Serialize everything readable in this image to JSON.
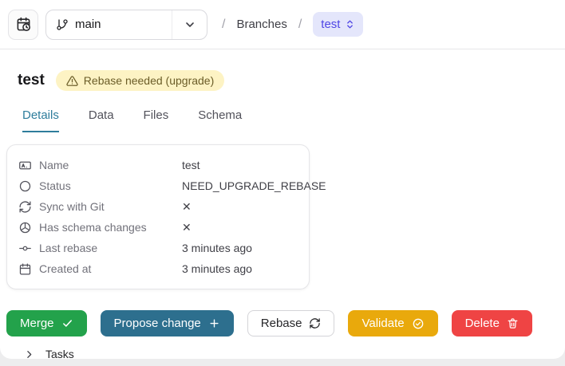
{
  "topbar": {
    "history_button": {
      "icon": "calendar-clock"
    },
    "branch_select": {
      "value": "main",
      "icon": "git-branch"
    },
    "breadcrumb": {
      "sep": "/",
      "section": "Branches",
      "current": "test"
    }
  },
  "header": {
    "title": "test",
    "badge": "Rebase needed (upgrade)"
  },
  "tabs": [
    {
      "label": "Details",
      "active": true
    },
    {
      "label": "Data",
      "active": false
    },
    {
      "label": "Files",
      "active": false
    },
    {
      "label": "Schema",
      "active": false
    }
  ],
  "details": {
    "rows": [
      {
        "icon": "name-field-icon",
        "label": "Name",
        "value": "test"
      },
      {
        "icon": "status-circle-icon",
        "label": "Status",
        "value": "NEED_UPGRADE_REBASE"
      },
      {
        "icon": "sync-icon",
        "label": "Sync with Git",
        "value": "✕"
      },
      {
        "icon": "schema-icon",
        "label": "Has schema changes",
        "value": "✕"
      },
      {
        "icon": "commit-icon",
        "label": "Last rebase",
        "value": "3 minutes ago"
      },
      {
        "icon": "calendar-icon",
        "label": "Created at",
        "value": "3 minutes ago"
      }
    ]
  },
  "actions": {
    "merge": "Merge",
    "propose": "Propose change",
    "rebase": "Rebase",
    "validate": "Validate",
    "delete": "Delete"
  },
  "tasks": {
    "label": "Tasks"
  },
  "colors": {
    "accent_teal": "#2d6f8e",
    "tab_active": "#2e7d9c",
    "merge_green": "#23a24b",
    "validate_amber": "#e9a90c",
    "delete_red": "#ef4444",
    "badge_bg": "#fdf3c4",
    "badge_text": "#6b5d28",
    "pill_indigo_text": "#4f46e5",
    "pill_indigo_bg": "#e4e6fb"
  }
}
